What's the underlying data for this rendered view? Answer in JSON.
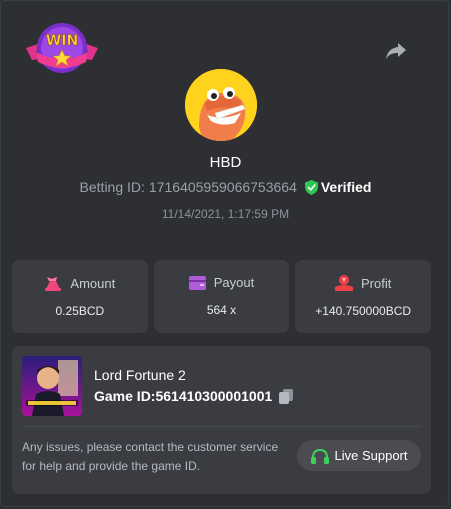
{
  "header": {
    "badge_icon": "win-badge-icon",
    "badge_text": "WIN",
    "share_icon": "share-arrow-icon"
  },
  "user": {
    "avatar_icon": "dinosaur-avatar-icon",
    "name": "HBD",
    "betting_id_label": "Betting ID:",
    "betting_id": "1716405959066753664",
    "verified_label": "Verified",
    "timestamp": "11/14/2021, 1:17:59 PM"
  },
  "stats": [
    {
      "icon": "money-bag-icon",
      "label": "Amount",
      "value": "0.25BCD",
      "icon_color": "#f0467c"
    },
    {
      "icon": "wallet-icon",
      "label": "Payout",
      "value": "564 x",
      "icon_color": "#b05bd9"
    },
    {
      "icon": "profit-icon",
      "label": "Profit",
      "value": "+140.750000BCD",
      "icon_color": "#ef4048"
    }
  ],
  "game": {
    "thumbnail_icon": "game-cover-icon",
    "title": "Lord Fortune 2",
    "id_label": "Game ID:",
    "id": "561410300001001",
    "copy_icon": "copy-icon",
    "help_text": "Any issues, please contact the customer service for help and provide the game ID.",
    "support_label": "Live Support",
    "support_icon": "headset-icon"
  },
  "colors": {
    "background": "#2d2f33",
    "card": "#3a3c41",
    "verified_green": "#2ec754",
    "support_green": "#3fd25a"
  }
}
